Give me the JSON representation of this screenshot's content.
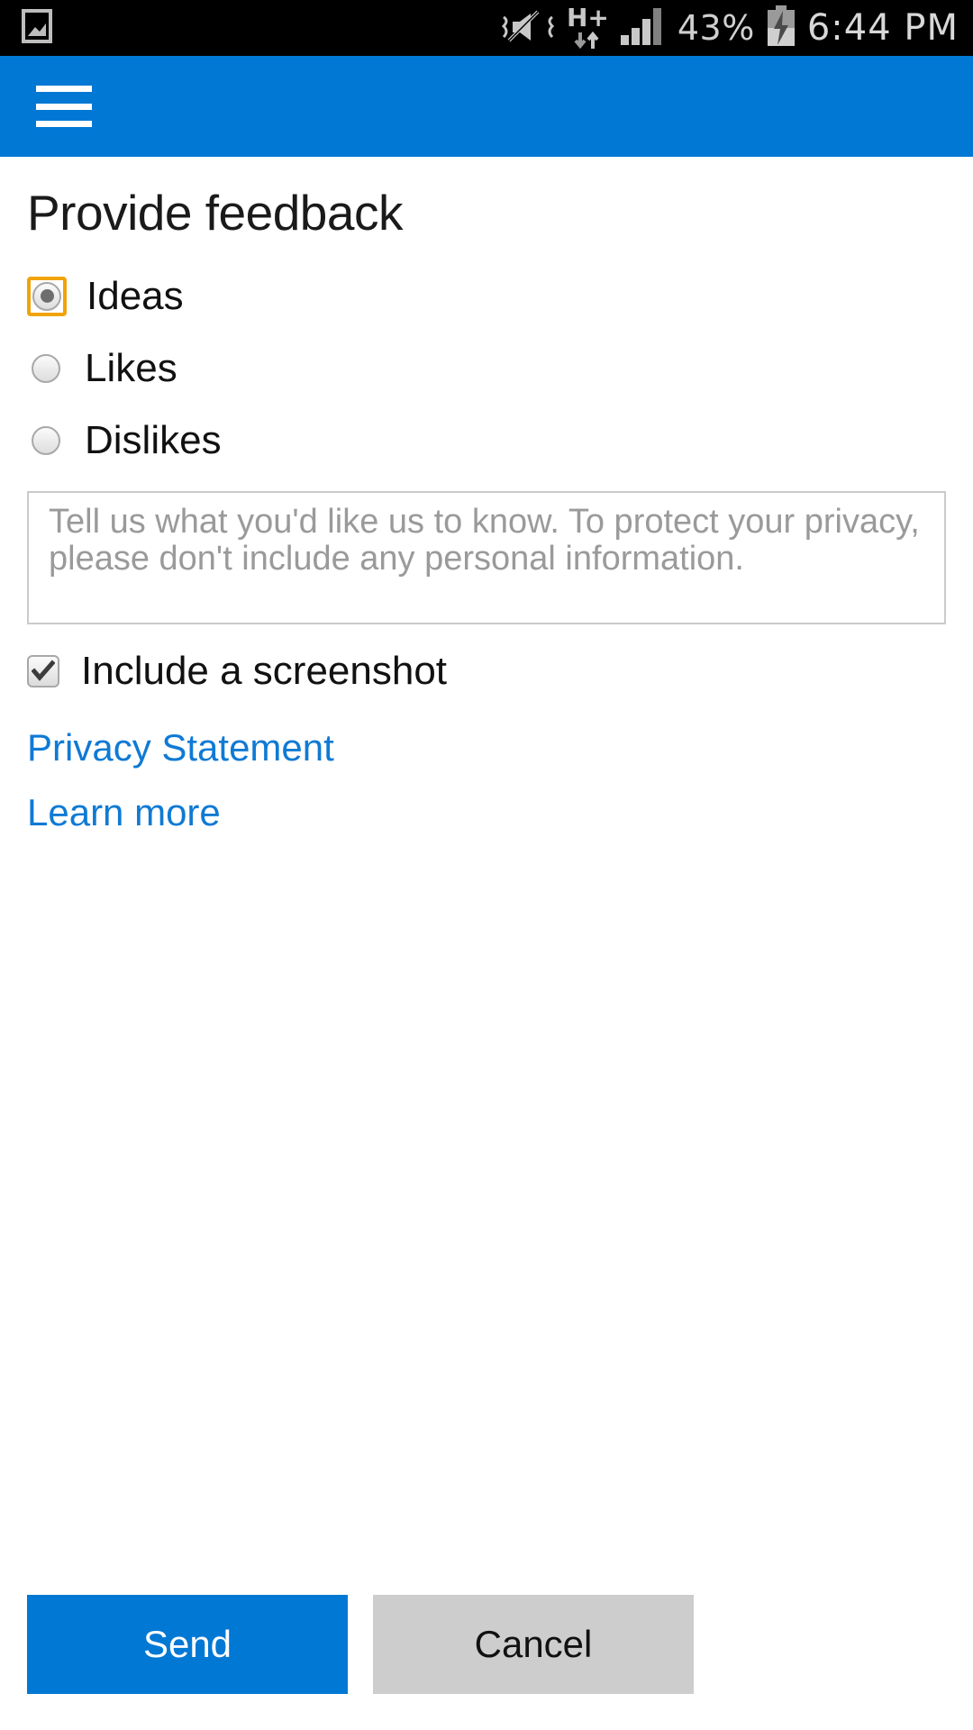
{
  "status_bar": {
    "left_icons": [
      {
        "name": "screenshot-image-icon",
        "glyph": "image"
      }
    ],
    "right_icons": [
      {
        "name": "vibrate-mute-icon",
        "glyph": "mute"
      },
      {
        "name": "hplus-data-icon",
        "label": "H+"
      },
      {
        "name": "signal-bars-icon",
        "glyph": "signal"
      }
    ],
    "battery_percent": "43%",
    "battery_state": "charging",
    "time": "6:44 PM"
  },
  "app_bar": {
    "menu_icon": "hamburger-menu-icon"
  },
  "page": {
    "title": "Provide feedback"
  },
  "feedback_type": {
    "selected": "Ideas",
    "options": [
      {
        "label": "Ideas",
        "checked": true,
        "focused": true
      },
      {
        "label": "Likes",
        "checked": false,
        "focused": false
      },
      {
        "label": "Dislikes",
        "checked": false,
        "focused": false
      }
    ]
  },
  "comment": {
    "value": "",
    "placeholder": "Tell us what you'd like us to know. To protect your privacy, please don't include any personal information."
  },
  "screenshot_option": {
    "label": "Include a screenshot",
    "checked": true
  },
  "links": [
    {
      "label": "Privacy Statement",
      "name": "privacy-statement-link"
    },
    {
      "label": "Learn more",
      "name": "learn-more-link"
    }
  ],
  "actions": {
    "send_label": "Send",
    "cancel_label": "Cancel"
  },
  "colors": {
    "accent_blue": "#0078d4",
    "link_blue": "#0f7ad4",
    "focus_orange": "#f0a30a",
    "cancel_gray": "#cdcdcd",
    "status_bar_black": "#000000"
  }
}
